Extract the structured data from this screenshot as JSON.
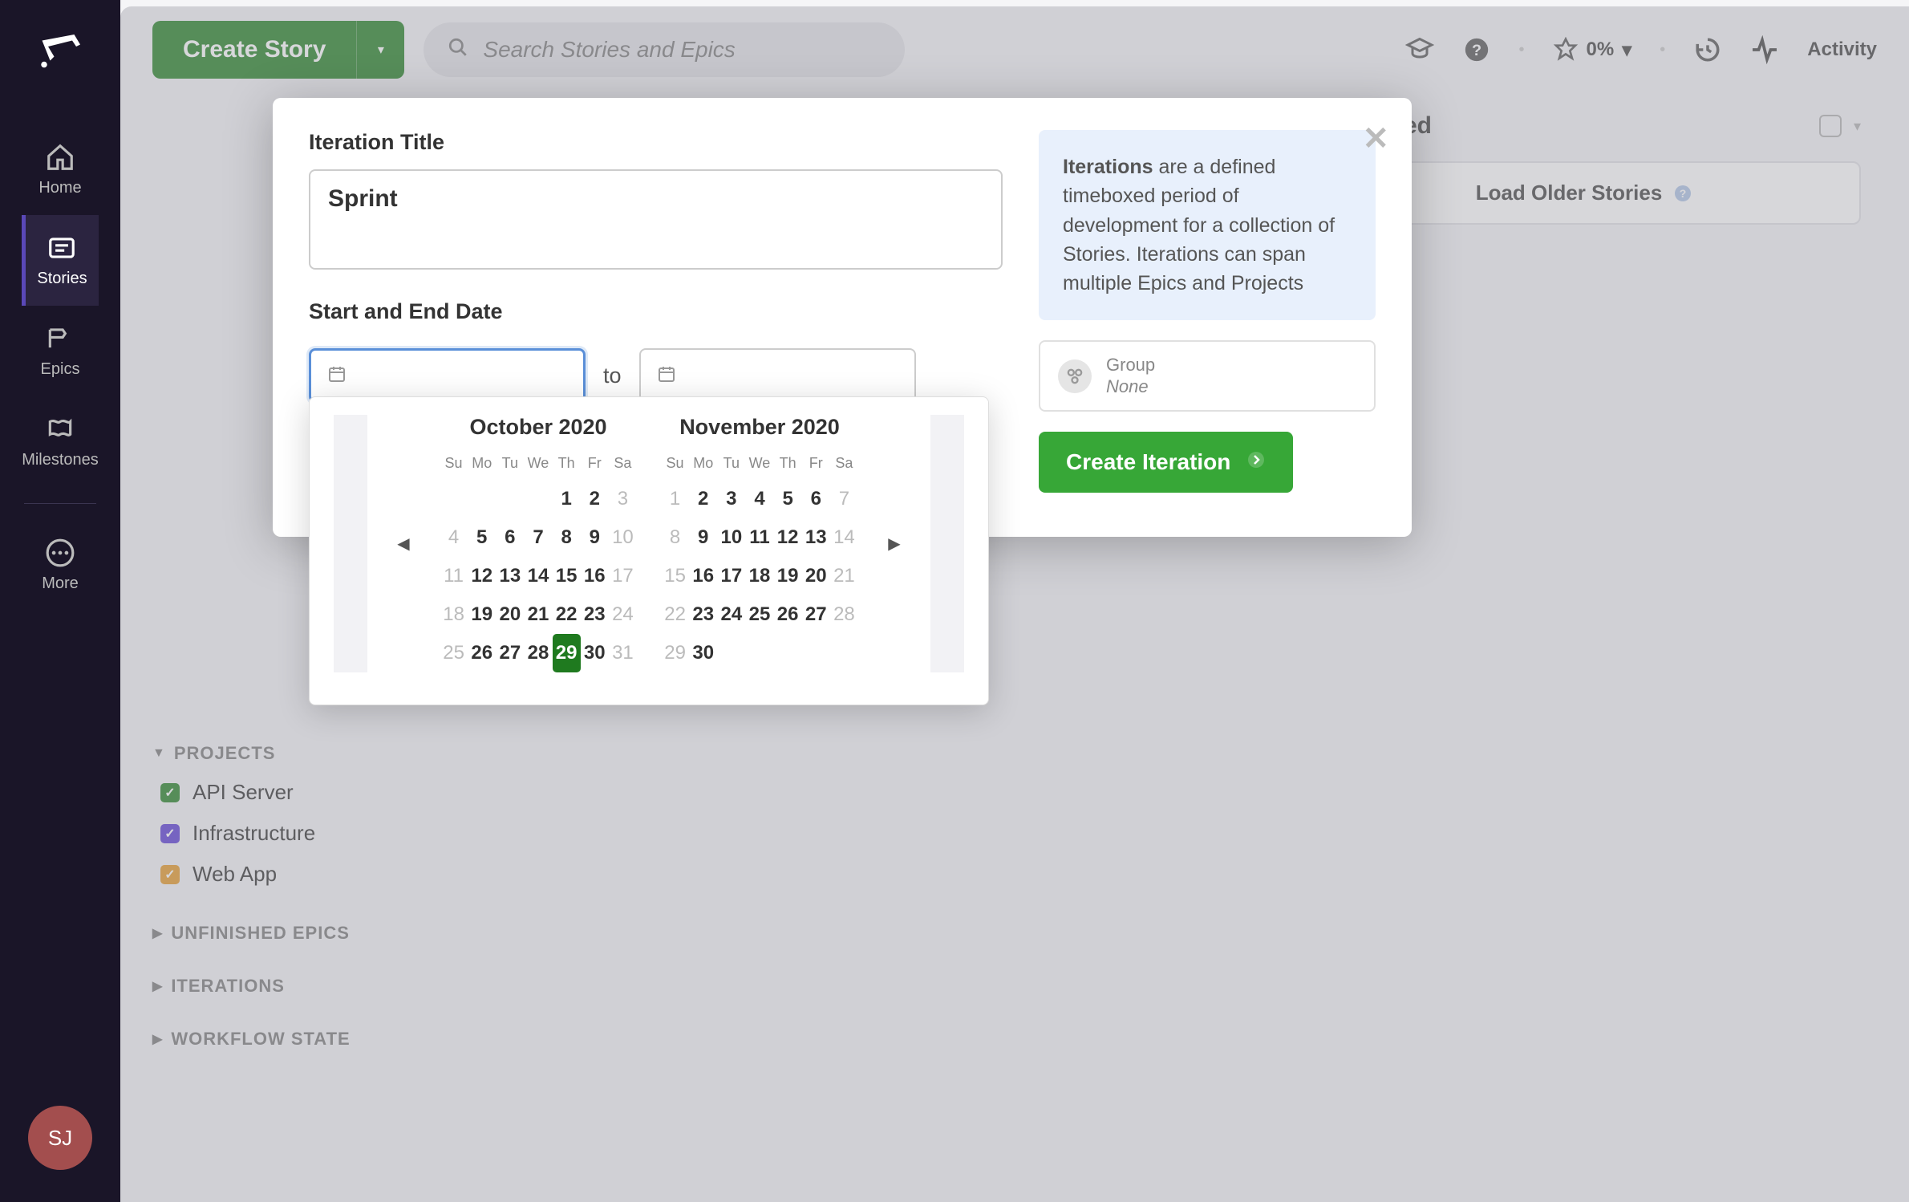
{
  "sidebar": {
    "items": [
      {
        "label": "Home",
        "icon": "home-icon"
      },
      {
        "label": "Stories",
        "icon": "stories-icon",
        "active": true
      },
      {
        "label": "Epics",
        "icon": "epics-icon"
      },
      {
        "label": "Milestones",
        "icon": "milestones-icon"
      },
      {
        "label": "More",
        "icon": "more-icon"
      }
    ],
    "avatar_initials": "SJ"
  },
  "topbar": {
    "create_label": "Create Story",
    "search_placeholder": "Search Stories and Epics",
    "percent_text": "0%",
    "activity_label": "Activity"
  },
  "column": {
    "title": "Completed",
    "load_older": "Load Older Stories"
  },
  "filters": {
    "projects_header": "PROJECTS",
    "projects": [
      {
        "label": "API Server",
        "color": "green"
      },
      {
        "label": "Infrastructure",
        "color": "purple"
      },
      {
        "label": "Web App",
        "color": "orange"
      }
    ],
    "sections": [
      "UNFINISHED EPICS",
      "ITERATIONS",
      "WORKFLOW STATE"
    ]
  },
  "modal": {
    "title_label": "Iteration Title",
    "title_value": "Sprint",
    "dates_label": "Start and End Date",
    "date_to": "to",
    "info_bold": "Iterations",
    "info_text": " are a defined timeboxed period of development for a collection of Stories. Iterations can span multiple Epics and Projects",
    "group_label": "Group",
    "group_value": "None",
    "create_btn": "Create Iteration"
  },
  "datepicker": {
    "dow": [
      "Su",
      "Mo",
      "Tu",
      "We",
      "Th",
      "Fr",
      "Sa"
    ],
    "months": [
      {
        "title": "October 2020",
        "cells": [
          {
            "d": "",
            "m": true
          },
          {
            "d": "",
            "m": true
          },
          {
            "d": "",
            "m": true
          },
          {
            "d": "",
            "m": true
          },
          {
            "d": "1"
          },
          {
            "d": "2"
          },
          {
            "d": "3",
            "m": true
          },
          {
            "d": "4",
            "m": true
          },
          {
            "d": "5"
          },
          {
            "d": "6"
          },
          {
            "d": "7"
          },
          {
            "d": "8"
          },
          {
            "d": "9"
          },
          {
            "d": "10",
            "m": true
          },
          {
            "d": "11",
            "m": true
          },
          {
            "d": "12"
          },
          {
            "d": "13"
          },
          {
            "d": "14"
          },
          {
            "d": "15"
          },
          {
            "d": "16"
          },
          {
            "d": "17",
            "m": true
          },
          {
            "d": "18",
            "m": true
          },
          {
            "d": "19"
          },
          {
            "d": "20"
          },
          {
            "d": "21"
          },
          {
            "d": "22"
          },
          {
            "d": "23"
          },
          {
            "d": "24",
            "m": true
          },
          {
            "d": "25",
            "m": true
          },
          {
            "d": "26"
          },
          {
            "d": "27"
          },
          {
            "d": "28"
          },
          {
            "d": "29",
            "today": true
          },
          {
            "d": "30"
          },
          {
            "d": "31",
            "m": true
          }
        ]
      },
      {
        "title": "November 2020",
        "cells": [
          {
            "d": "1",
            "m": true
          },
          {
            "d": "2"
          },
          {
            "d": "3"
          },
          {
            "d": "4"
          },
          {
            "d": "5"
          },
          {
            "d": "6"
          },
          {
            "d": "7",
            "m": true
          },
          {
            "d": "8",
            "m": true
          },
          {
            "d": "9"
          },
          {
            "d": "10"
          },
          {
            "d": "11"
          },
          {
            "d": "12"
          },
          {
            "d": "13"
          },
          {
            "d": "14",
            "m": true
          },
          {
            "d": "15",
            "m": true
          },
          {
            "d": "16"
          },
          {
            "d": "17"
          },
          {
            "d": "18"
          },
          {
            "d": "19"
          },
          {
            "d": "20"
          },
          {
            "d": "21",
            "m": true
          },
          {
            "d": "22",
            "m": true
          },
          {
            "d": "23"
          },
          {
            "d": "24"
          },
          {
            "d": "25"
          },
          {
            "d": "26"
          },
          {
            "d": "27"
          },
          {
            "d": "28",
            "m": true
          },
          {
            "d": "29",
            "m": true
          },
          {
            "d": "30"
          },
          {
            "d": "",
            "m": true
          },
          {
            "d": "",
            "m": true
          },
          {
            "d": "",
            "m": true
          },
          {
            "d": "",
            "m": true
          },
          {
            "d": "",
            "m": true
          }
        ]
      }
    ]
  }
}
